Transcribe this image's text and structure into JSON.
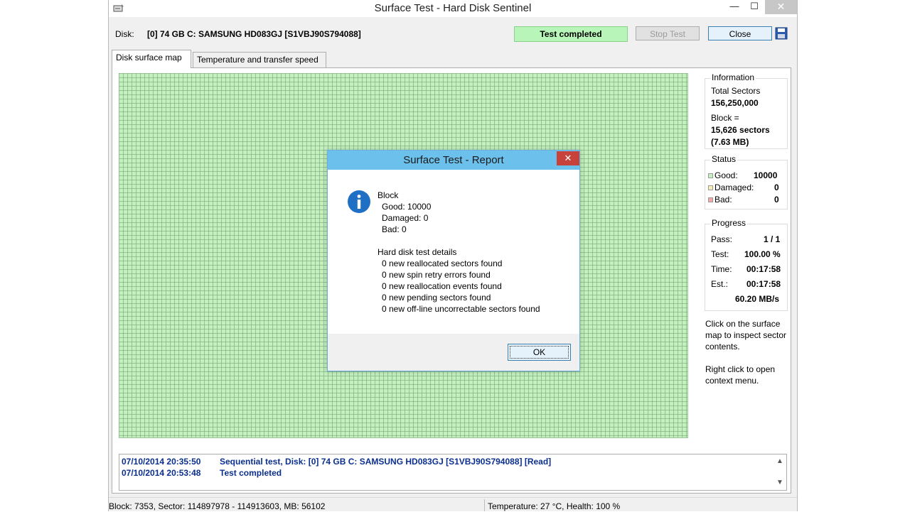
{
  "window": {
    "title": "Surface Test - Hard Disk Sentinel",
    "min_glyph": "—",
    "max_glyph": "☐",
    "close_glyph": "✕"
  },
  "diskbar": {
    "label": "Disk:",
    "value": "[0] 74 GB C: SAMSUNG HD083GJ [S1VBJ90S794088]",
    "status": "Test completed",
    "stop_label": "Stop Test",
    "close_label": "Close"
  },
  "tabs": [
    {
      "label": "Disk surface map"
    },
    {
      "label": "Temperature and transfer speed"
    }
  ],
  "information": {
    "title": "Information",
    "total_sectors_label": "Total Sectors",
    "total_sectors_value": "156,250,000",
    "block_label": "Block =",
    "block_value": "15,626 sectors",
    "block_size": "(7.63 MB)"
  },
  "status": {
    "title": "Status",
    "good_label": "Good:",
    "good_value": "10000",
    "damaged_label": "Damaged:",
    "damaged_value": "0",
    "bad_label": "Bad:",
    "bad_value": "0"
  },
  "progress": {
    "title": "Progress",
    "pass_label": "Pass:",
    "pass_value": "1 / 1",
    "test_label": "Test:",
    "test_value": "100.00 %",
    "time_label": "Time:",
    "time_value": "00:17:58",
    "est_label": "Est.:",
    "est_value": "00:17:58",
    "speed": "60.20 MB/s"
  },
  "hints": {
    "inspect": "Click on the surface map to inspect sector contents.",
    "context": "Right click to open context menu."
  },
  "log": [
    {
      "timestamp": "07/10/2014  20:35:50",
      "message": "Sequential test, Disk: [0] 74 GB C: SAMSUNG HD083GJ [S1VBJ90S794088] [Read]"
    },
    {
      "timestamp": "07/10/2014  20:53:48",
      "message": "Test completed"
    }
  ],
  "statusbar": {
    "left": "Block: 7353, Sector: 114897978 - 114913603, MB: 56102",
    "right": "Temperature: 27  °C,  Health: 100 %"
  },
  "dialog": {
    "title": "Surface Test - Report",
    "close_glyph": "✕",
    "lines": [
      "Block",
      "  Good: 10000",
      "  Damaged: 0",
      "  Bad: 0",
      "",
      "Hard disk test details",
      "  0 new reallocated sectors found",
      "  0 new spin retry errors found",
      "  0 new reallocation events found",
      "  0 new pending sectors found",
      "  0 new off-line uncorrectable sectors found"
    ],
    "ok_label": "OK"
  },
  "colors": {
    "good": "#c4f0c0",
    "dialog_title": "#6cc0ec",
    "close_red": "#c7423a",
    "log_text": "#0b2f8f"
  }
}
